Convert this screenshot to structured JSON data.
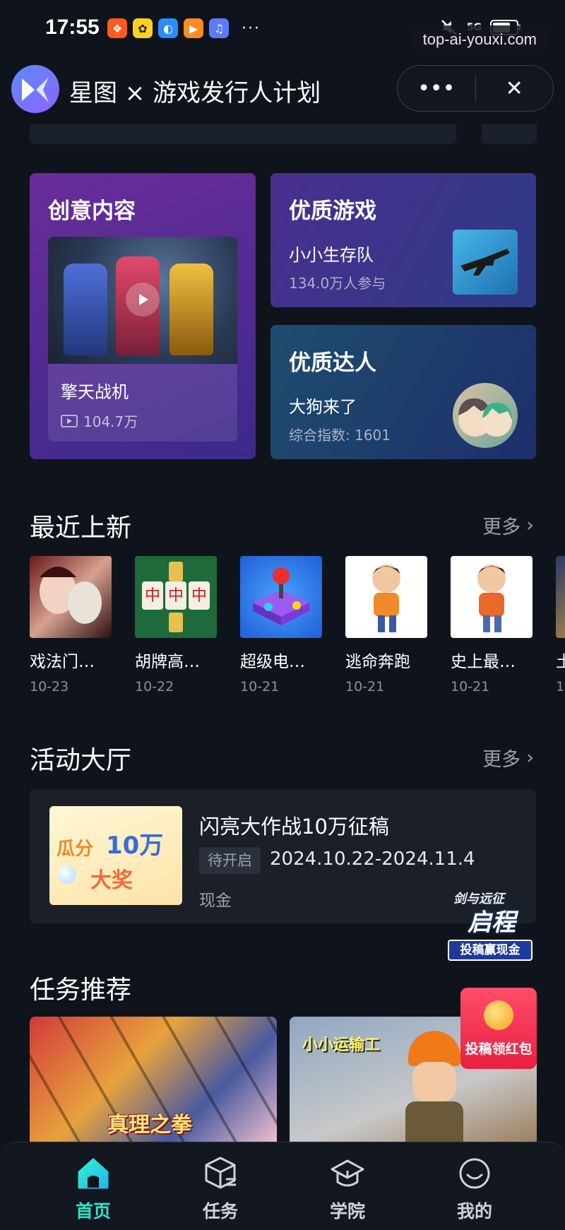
{
  "status_bar": {
    "time": "17:55",
    "more": "···",
    "network": "5G",
    "watermark": "top-ai-youxi.com"
  },
  "header": {
    "title": "星图 × 游戏发行人计划",
    "more_label": "•••",
    "close_label": "✕"
  },
  "cards": {
    "creative": {
      "heading": "创意内容",
      "video_title": "擎天战机",
      "video_views": "104.7万"
    },
    "game": {
      "heading": "优质游戏",
      "name": "小小生存队",
      "participants": "134.0万人参与"
    },
    "talent": {
      "heading": "优质达人",
      "name": "大狗来了",
      "index": "综合指数: 1601"
    }
  },
  "recent": {
    "title": "最近上新",
    "more": "更多",
    "items": [
      {
        "name": "戏法门…",
        "date": "10-23"
      },
      {
        "name": "胡牌高…",
        "date": "10-22"
      },
      {
        "name": "超级电…",
        "date": "10-21"
      },
      {
        "name": "逃命奔跑",
        "date": "10-21"
      },
      {
        "name": "史上最…",
        "date": "10-21"
      },
      {
        "name": "土",
        "date": "1"
      }
    ]
  },
  "activity": {
    "title": "活动大厅",
    "more": "更多",
    "banner_text_1": "瓜分",
    "banner_text_2": "10万",
    "banner_text_3": "大奖",
    "name": "闪亮大作战10万征稿",
    "status": "待开启",
    "dates": "2024.10.22-2024.11.4",
    "reward": "现金",
    "promo_line1": "剑与远征",
    "promo_line2": "启程",
    "promo_line3": "投稿赢现金"
  },
  "tasks": {
    "title": "任务推荐",
    "task1_caption": "真理之拳",
    "task2_caption": "小小运输工",
    "redpack_label": "投稿领红包"
  },
  "bottom_nav": {
    "items": [
      {
        "label": "首页",
        "active": true
      },
      {
        "label": "任务",
        "active": false
      },
      {
        "label": "学院",
        "active": false
      },
      {
        "label": "我的",
        "active": false
      }
    ],
    "active_color": "#2fe3c8"
  }
}
